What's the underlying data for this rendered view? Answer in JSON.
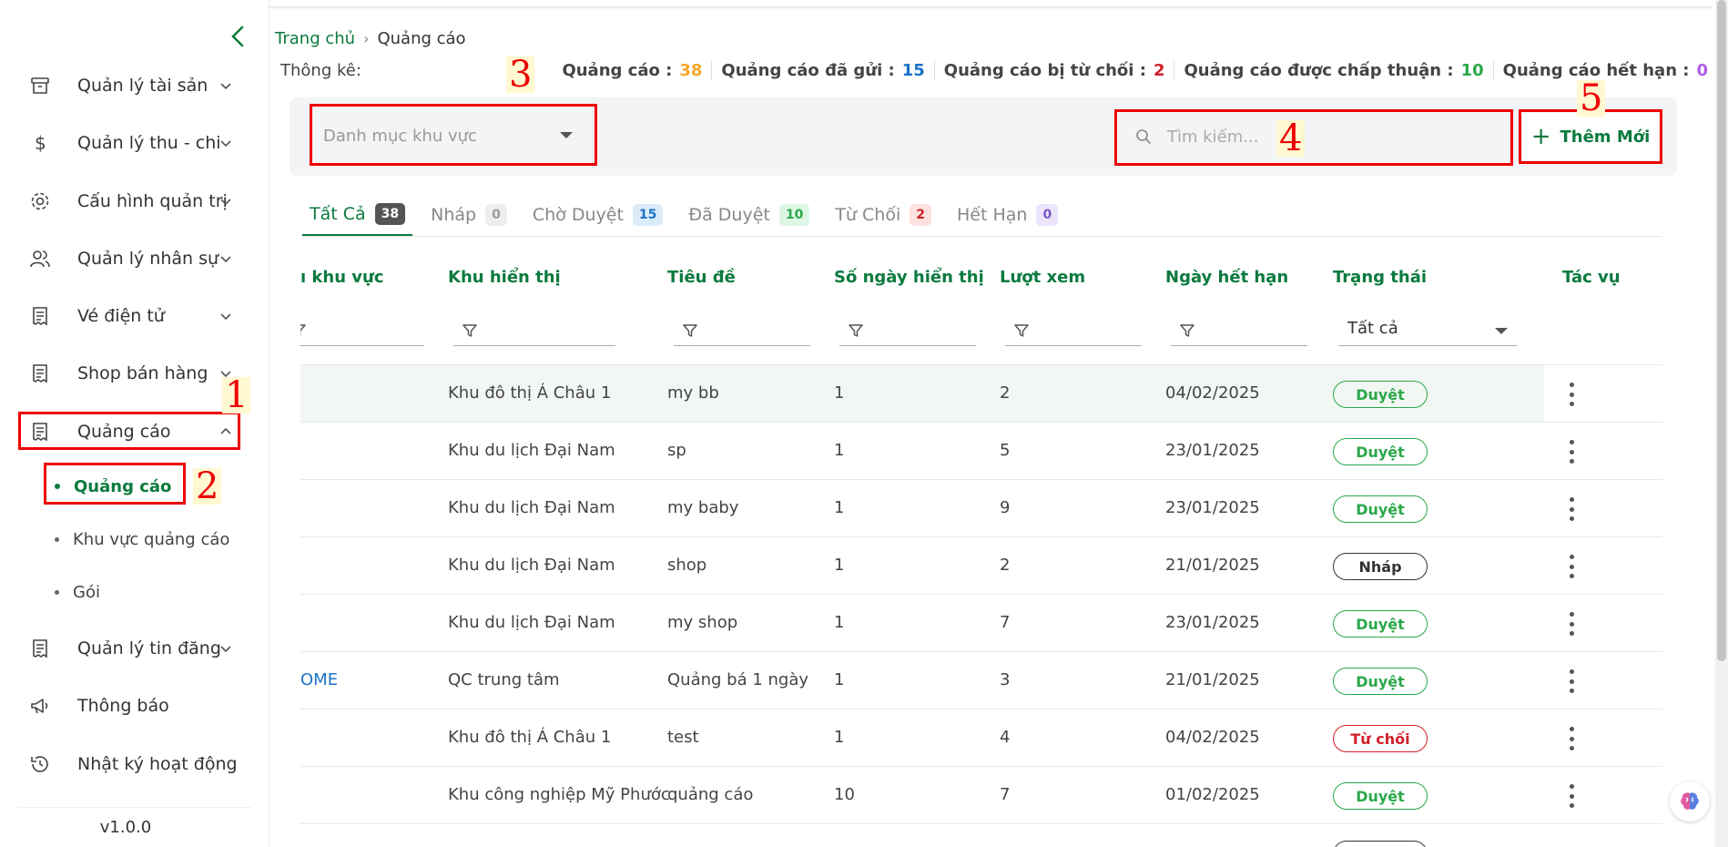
{
  "sidebar": {
    "collapse_icon": "chevron-left-icon",
    "items": [
      {
        "label": "Quản lý tài sản",
        "icon": "archive-icon"
      },
      {
        "label": "Quản lý thu - chi",
        "icon": "dollar-icon"
      },
      {
        "label": "Cấu hình quản trị",
        "icon": "gear-icon"
      },
      {
        "label": "Quản lý nhân sự",
        "icon": "users-icon"
      },
      {
        "label": "Vé điện tử",
        "icon": "receipt-icon"
      },
      {
        "label": "Shop bán hàng",
        "icon": "receipt-icon"
      },
      {
        "label": "Quảng cáo",
        "icon": "receipt-icon"
      },
      {
        "label": "Quản lý tin đăng",
        "icon": "receipt-icon"
      },
      {
        "label": "Thông báo",
        "icon": "megaphone-icon"
      },
      {
        "label": "Nhật ký hoạt động",
        "icon": "history-icon"
      }
    ],
    "subitems": [
      {
        "label": "Quảng cáo",
        "active": true
      },
      {
        "label": "Khu vực quảng cáo",
        "active": false
      },
      {
        "label": "Gói",
        "active": false
      }
    ],
    "version": "v1.0.0"
  },
  "annotations": [
    "1",
    "2",
    "3",
    "4",
    "5"
  ],
  "breadcrumb": {
    "home": "Trang chủ",
    "separator": "›",
    "current": "Quảng cáo"
  },
  "stats": {
    "label": "Thông kê:",
    "items": [
      {
        "label": "Quảng cáo :",
        "value": "38",
        "color": "#f5a623"
      },
      {
        "label": "Quảng cáo đã gửi :",
        "value": "15",
        "color": "#1a73c8"
      },
      {
        "label": "Quảng cáo bị từ chối :",
        "value": "2",
        "color": "#d0202a"
      },
      {
        "label": "Quảng cáo được chấp thuận :",
        "value": "10",
        "color": "#2aa84a"
      },
      {
        "label": "Quảng cáo hết hạn :",
        "value": "0",
        "color": "#b05de8"
      }
    ]
  },
  "filters": {
    "region_placeholder": "Danh mục khu vực",
    "search_placeholder": "Tìm kiếm...",
    "add_label": "Thêm Mới"
  },
  "tabs": [
    {
      "label": "Tất Cả",
      "count": "38",
      "active": true,
      "badge_bg": "#555555",
      "badge_fg": "#ffffff"
    },
    {
      "label": "Nháp",
      "count": "0",
      "active": false,
      "badge_bg": "#eeeeee",
      "badge_fg": "#999999"
    },
    {
      "label": "Chờ Duyệt",
      "count": "15",
      "active": false,
      "badge_bg": "#dcebfa",
      "badge_fg": "#1a73c8"
    },
    {
      "label": "Đã Duyệt",
      "count": "10",
      "active": false,
      "badge_bg": "#ddf6e3",
      "badge_fg": "#2aa84a"
    },
    {
      "label": "Từ Chối",
      "count": "2",
      "active": false,
      "badge_bg": "#fde1e1",
      "badge_fg": "#d0202a"
    },
    {
      "label": "Hết Hạn",
      "count": "0",
      "active": false,
      "badge_bg": "#ece4fa",
      "badge_fg": "#7a55c8"
    }
  ],
  "table": {
    "columns": [
      "ı khu vực",
      "Khu hiển thị",
      "Tiêu đề",
      "Số ngày hiển thị",
      "Lượt xem",
      "Ngày hết hạn",
      "Trạng thái",
      "Tác vụ"
    ],
    "status_filter": "Tất cả",
    "rows": [
      {
        "region": "",
        "area": "Khu đô thị Á Châu 1",
        "title": "my bb",
        "days": "1",
        "views": "2",
        "expiry": "04/02/2025",
        "status": "Duyệt",
        "status_kind": "duyet",
        "highlight": true
      },
      {
        "region": "",
        "area": "Khu du lịch Đại Nam",
        "title": "sp",
        "days": "1",
        "views": "5",
        "expiry": "23/01/2025",
        "status": "Duyệt",
        "status_kind": "duyet"
      },
      {
        "region": "",
        "area": "Khu du lịch Đại Nam",
        "title": "my baby",
        "days": "1",
        "views": "9",
        "expiry": "23/01/2025",
        "status": "Duyệt",
        "status_kind": "duyet"
      },
      {
        "region": "",
        "area": "Khu du lịch Đại Nam",
        "title": "shop",
        "days": "1",
        "views": "2",
        "expiry": "21/01/2025",
        "status": "Nháp",
        "status_kind": "nhap"
      },
      {
        "region": "",
        "area": "Khu du lịch Đại Nam",
        "title": "my shop",
        "days": "1",
        "views": "7",
        "expiry": "23/01/2025",
        "status": "Duyệt",
        "status_kind": "duyet"
      },
      {
        "region": "OME",
        "area": "QC trung tâm",
        "title": "Quảng bá 1 ngày",
        "days": "1",
        "views": "3",
        "expiry": "21/01/2025",
        "status": "Duyệt",
        "status_kind": "duyet"
      },
      {
        "region": "",
        "area": "Khu đô thị Á Châu 1",
        "title": "test",
        "days": "1",
        "views": "4",
        "expiry": "04/02/2025",
        "status": "Từ chối",
        "status_kind": "tuchoi"
      },
      {
        "region": "",
        "area": "Khu công nghiệp Mỹ Phước",
        "title": "quảng cáo",
        "days": "10",
        "views": "7",
        "expiry": "01/02/2025",
        "status": "Duyệt",
        "status_kind": "duyet"
      }
    ]
  }
}
